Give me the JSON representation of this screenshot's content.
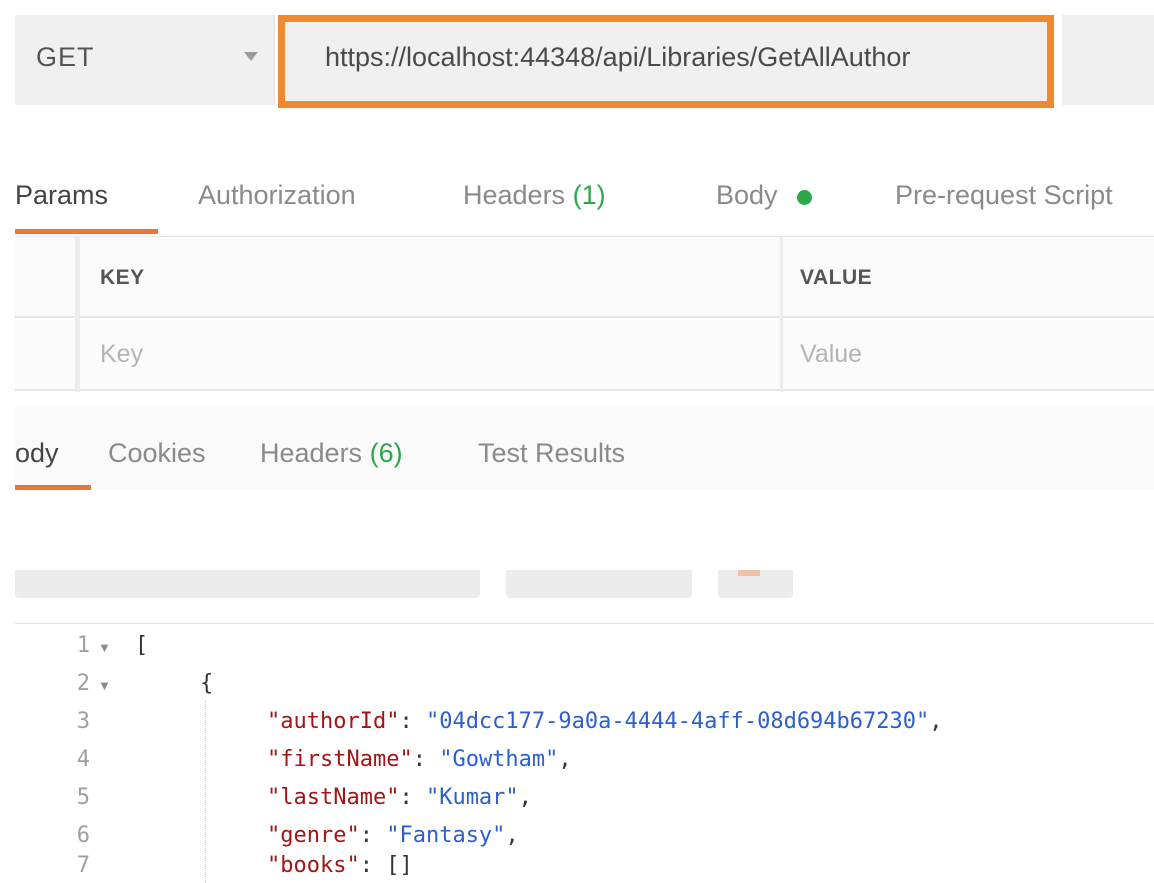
{
  "request": {
    "method": "GET",
    "url": "https://localhost:44348/api/Libraries/GetAllAuthor"
  },
  "request_tabs": {
    "params": "Params",
    "authorization": "Authorization",
    "headers_label": "Headers",
    "headers_count": "(1)",
    "body": "Body",
    "prerequest": "Pre-request Script"
  },
  "params_table": {
    "key_header": "KEY",
    "value_header": "VALUE",
    "key_placeholder": "Key",
    "value_placeholder": "Value"
  },
  "response_tabs": {
    "body": "ody",
    "cookies": "Cookies",
    "headers_label": "Headers",
    "headers_count": "(6)",
    "test_results": "Test Results"
  },
  "code": {
    "lines": [
      {
        "num": "1",
        "fold": true
      },
      {
        "num": "2",
        "fold": true
      },
      {
        "num": "3",
        "fold": false
      },
      {
        "num": "4",
        "fold": false
      },
      {
        "num": "5",
        "fold": false
      },
      {
        "num": "6",
        "fold": false
      },
      {
        "num": "7",
        "fold": false
      }
    ],
    "open_bracket": "[",
    "open_brace": "{",
    "fields": [
      {
        "key": "\"authorId\"",
        "value": "\"04dcc177-9a0a-4444-4aff-08d694b67230\"",
        "trail": ","
      },
      {
        "key": "\"firstName\"",
        "value": "\"Gowtham\"",
        "trail": ","
      },
      {
        "key": "\"lastName\"",
        "value": "\"Kumar\"",
        "trail": ","
      },
      {
        "key": "\"genre\"",
        "value": "\"Fantasy\"",
        "trail": ","
      },
      {
        "key": "\"books\"",
        "value": "[]",
        "trail": ""
      }
    ]
  },
  "colors": {
    "accent_orange": "#ef8a32",
    "tab_underline": "#e8773a",
    "count_green": "#2ca84a",
    "json_key": "#a31515",
    "json_string": "#2b5fcc"
  },
  "icons": {
    "method_caret": "chevron-down-icon",
    "fold_arrow": "fold-arrow-icon",
    "body_indicator": "dot-icon"
  }
}
